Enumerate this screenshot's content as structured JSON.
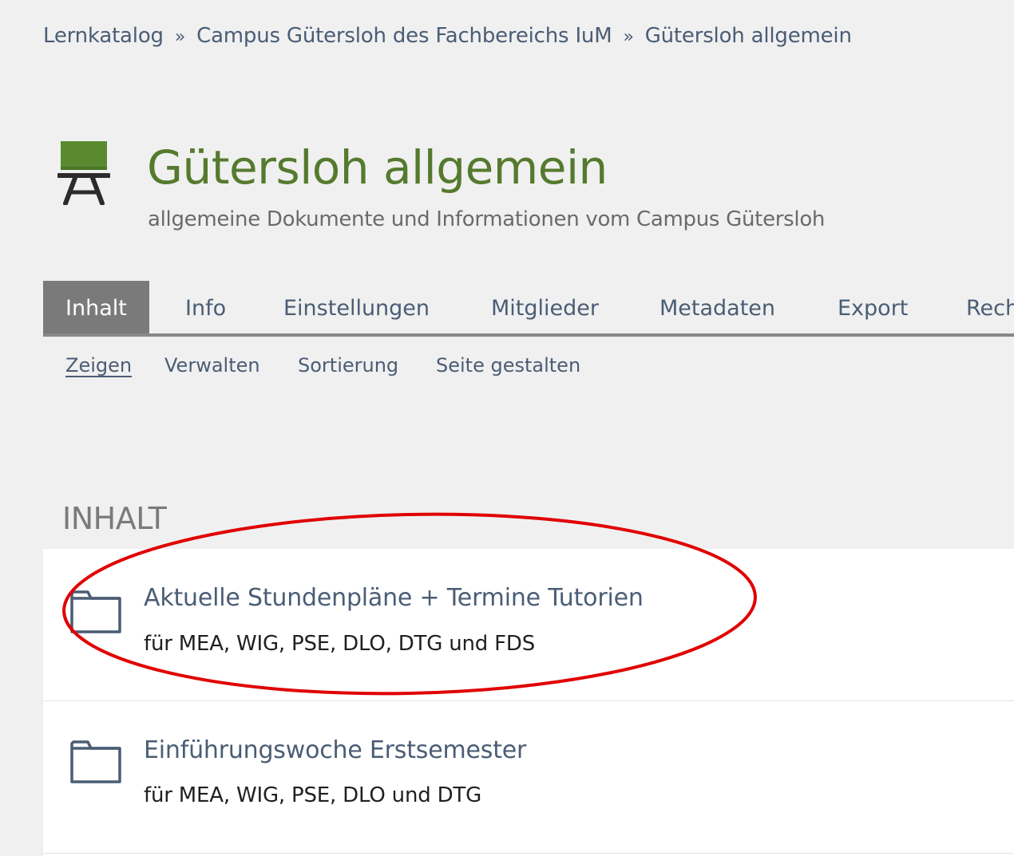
{
  "breadcrumb": {
    "items": [
      "Lernkatalog",
      "Campus Gütersloh des Fachbereichs IuM",
      "Gütersloh allgemein"
    ],
    "separator": "»"
  },
  "header": {
    "icon": "course-board-icon",
    "title": "Gütersloh allgemein",
    "description": "allgemeine Dokumente und Informationen vom Campus Gütersloh",
    "title_color": "#557a2e"
  },
  "tabs": [
    {
      "label": "Inhalt",
      "active": true
    },
    {
      "label": "Info",
      "active": false
    },
    {
      "label": "Einstellungen",
      "active": false
    },
    {
      "label": "Mitglieder",
      "active": false
    },
    {
      "label": "Metadaten",
      "active": false
    },
    {
      "label": "Export",
      "active": false
    },
    {
      "label": "Rech",
      "active": false
    }
  ],
  "subtabs": [
    {
      "label": "Zeigen",
      "active": true
    },
    {
      "label": "Verwalten",
      "active": false
    },
    {
      "label": "Sortierung",
      "active": false
    },
    {
      "label": "Seite gestalten",
      "active": false
    }
  ],
  "content": {
    "heading": "INHALT",
    "items": [
      {
        "icon": "folder-icon",
        "title": "Aktuelle Stundenpläne + Termine Tutorien",
        "description": "für MEA, WIG, PSE, DLO, DTG und FDS"
      },
      {
        "icon": "folder-icon",
        "title": "Einführungswoche Erstsemester",
        "description": "für MEA, WIG, PSE, DLO und DTG"
      }
    ]
  },
  "annotation": {
    "type": "ellipse",
    "color": "#e00000"
  }
}
